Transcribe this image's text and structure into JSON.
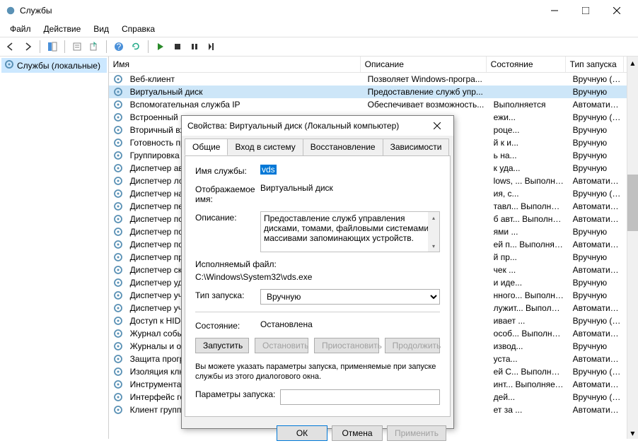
{
  "window": {
    "title": "Службы",
    "menu": [
      "Файл",
      "Действие",
      "Вид",
      "Справка"
    ]
  },
  "tree": {
    "root": "Службы (локальные)"
  },
  "list": {
    "headers": {
      "name": "Имя",
      "desc": "Описание",
      "state": "Состояние",
      "start": "Тип запуска"
    },
    "rows": [
      {
        "name": "Веб-клиент",
        "desc": "Позволяет Windows-програ...",
        "state": "",
        "start": "Вручную (ак..."
      },
      {
        "name": "Виртуальный диск",
        "desc": "Предоставление служб упр...",
        "state": "",
        "start": "Вручную",
        "selected": true
      },
      {
        "name": "Вспомогательная служба IP",
        "desc": "Обеспечивает возможность...",
        "state": "Выполняется",
        "start": "Автоматиче..."
      },
      {
        "name": "Встроенный режим",
        "desc": "",
        "state": "ежи...",
        "start": "Вручную (ак..."
      },
      {
        "name": "Вторичный вход",
        "desc": "",
        "state": "роце...",
        "start": "Вручную"
      },
      {
        "name": "Готовность при",
        "desc": "",
        "state": "й к и...",
        "start": "Вручную"
      },
      {
        "name": "Группировка сет",
        "desc": "",
        "state": "ь на...",
        "start": "Вручную"
      },
      {
        "name": "Диспетчер авто",
        "desc": "",
        "state": "к уда...",
        "start": "Вручную"
      },
      {
        "name": "Диспетчер лока",
        "desc": "",
        "state": "lows, ...    Выполняется",
        "start": "Автоматиче..."
      },
      {
        "name": "Диспетчер настр",
        "desc": "",
        "state": "ия, с...",
        "start": "Вручную (ак..."
      },
      {
        "name": "Диспетчер печа",
        "desc": "",
        "state": "тавл...    Выполняется",
        "start": "Автоматиче..."
      },
      {
        "name": "Диспетчер подк",
        "desc": "",
        "state": "б авт...    Выполняется",
        "start": "Автоматиче..."
      },
      {
        "name": "Диспетчер подк",
        "desc": "",
        "state": "ями ...",
        "start": "Вручную"
      },
      {
        "name": "Диспетчер поль",
        "desc": "",
        "state": "ей п...    Выполняется",
        "start": "Автоматиче..."
      },
      {
        "name": "Диспетчер пров",
        "desc": "",
        "state": "й пр...",
        "start": "Вручную"
      },
      {
        "name": "Диспетчер скача",
        "desc": "",
        "state": "чек ...",
        "start": "Автоматиче..."
      },
      {
        "name": "Диспетчер удост",
        "desc": "",
        "state": "и иде...",
        "start": "Вручную"
      },
      {
        "name": "Диспетчер учетн",
        "desc": "",
        "state": "нного...    Выполняется",
        "start": "Вручную"
      },
      {
        "name": "Диспетчер учетн",
        "desc": "",
        "state": "лужит...    Выполняется",
        "start": "Автоматиче..."
      },
      {
        "name": "Доступ к HID-ус",
        "desc": "",
        "state": "ивает ...",
        "start": "Вручную (ак..."
      },
      {
        "name": "Журнал событи",
        "desc": "",
        "state": "особ...    Выполняется",
        "start": "Автоматиче..."
      },
      {
        "name": "Журналы и опов",
        "desc": "",
        "state": "извод...",
        "start": "Вручную"
      },
      {
        "name": "Защита програм",
        "desc": "",
        "state": "уста...",
        "start": "Автоматиче..."
      },
      {
        "name": "Изоляция ключе",
        "desc": "",
        "state": "ей С...    Выполняется",
        "start": "Вручную (ак..."
      },
      {
        "name": "Инструментари",
        "desc": "",
        "state": "инт...    Выполняется",
        "start": "Автоматиче..."
      },
      {
        "name": "Интерфейс госте",
        "desc": "",
        "state": "дей...",
        "start": "Вручную (ак..."
      },
      {
        "name": "Клиент группово",
        "desc": "",
        "state": "ет за ...",
        "start": "Автоматиче..."
      }
    ]
  },
  "dialog": {
    "title": "Свойства: Виртуальный диск (Локальный компьютер)",
    "tabs": [
      "Общие",
      "Вход в систему",
      "Восстановление",
      "Зависимости"
    ],
    "labels": {
      "serviceName": "Имя службы:",
      "displayName": "Отображаемое имя:",
      "description": "Описание:",
      "exePath": "Исполняемый файл:",
      "startType": "Тип запуска:",
      "status": "Состояние:",
      "startParams": "Параметры запуска:"
    },
    "values": {
      "serviceName": "vds",
      "displayName": "Виртуальный диск",
      "description": "Предоставление служб управления дисками, томами, файловыми системами и массивами запоминающих устройств.",
      "exePath": "C:\\Windows\\System32\\vds.exe",
      "startType": "Вручную",
      "status": "Остановлена",
      "help": "Вы можете указать параметры запуска, применяемые при запуске службы из этого диалогового окна."
    },
    "buttons": {
      "start": "Запустить",
      "stop": "Остановить",
      "pause": "Приостановить",
      "resume": "Продолжить",
      "ok": "ОК",
      "cancel": "Отмена",
      "apply": "Применить"
    }
  }
}
